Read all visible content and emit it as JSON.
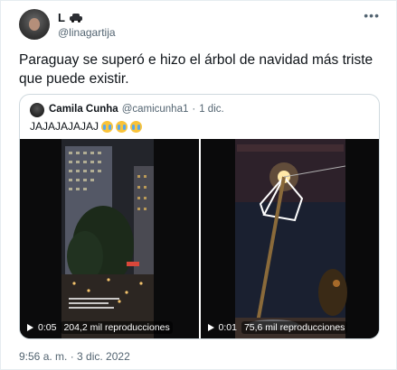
{
  "author": {
    "name": "L",
    "handle": "@linagartija"
  },
  "menu_icon": "more-horizontal-icon",
  "tweet_text": "Paraguay se superó e hizo el árbol de navidad más triste que puede existir.",
  "quoted": {
    "name": "Camila Cunha",
    "handle": "@camicunha1",
    "separator": "·",
    "date": "1 dic.",
    "text": "JAJAJAJAJAJ",
    "emojis": [
      "crying-face-icon",
      "crying-face-icon",
      "crying-face-icon"
    ],
    "videos": [
      {
        "time": "0:05",
        "views": "204,2 mil reproducciones"
      },
      {
        "time": "0:01",
        "views": "75,6 mil reproducciones"
      }
    ]
  },
  "timestamp": "9:56 a. m. · 3 dic. 2022",
  "colors": {
    "text": "#0f1419",
    "secondary": "#536471",
    "border": "#cfd9de"
  }
}
